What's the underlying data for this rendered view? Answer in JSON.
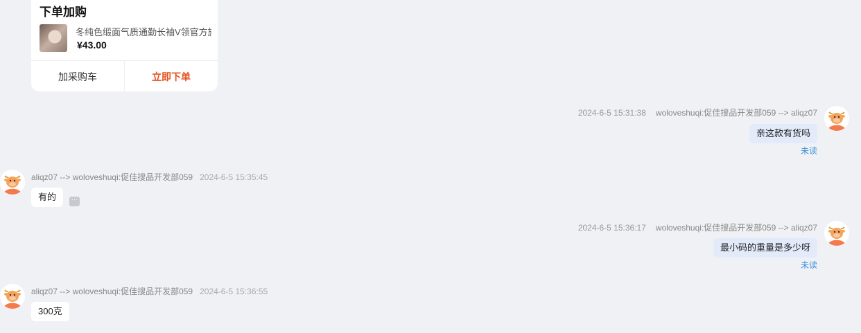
{
  "order_card": {
    "title": "下单加购",
    "product_name": "冬纯色缎面气质通勤长袖V领官方旗舰店",
    "price": "¥43.00",
    "add_cart_label": "加采购车",
    "buy_now_label": "立即下单",
    "buy_color": "#e5501f"
  },
  "messages": [
    {
      "direction": "outgoing",
      "time": "2024-6-5 15:31:38",
      "sender": "woloveshuqi:促佳搜品开发部059 --> aliqz07",
      "text": "亲这款有货吗",
      "status": "未读"
    },
    {
      "direction": "incoming",
      "sender": "aliqz07 --> woloveshuqi:促佳搜品开发部059",
      "time": "2024-6-5 15:35:45",
      "text": "有的",
      "more_label": "···"
    },
    {
      "direction": "outgoing",
      "time": "2024-6-5 15:36:17",
      "sender": "woloveshuqi:促佳搜品开发部059 --> aliqz07",
      "text": "最小码的重量是多少呀",
      "status": "未读"
    },
    {
      "direction": "incoming",
      "sender": "aliqz07 --> woloveshuqi:促佳搜品开发部059",
      "time": "2024-6-5 15:36:55",
      "text": "300克"
    }
  ],
  "colors": {
    "background": "#f0f1f5",
    "outgoing_bubble": "#e3ebfb",
    "incoming_bubble": "#ffffff",
    "unread": "#3c8fe0",
    "avatar_orange": "#f37a4a"
  },
  "icons": {
    "avatar": "cartoon-cow-avatar",
    "more": "ellipsis-icon"
  }
}
